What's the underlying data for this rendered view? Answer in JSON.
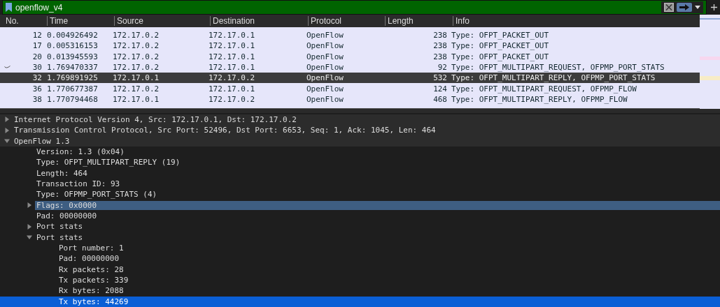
{
  "filter": {
    "value": "openflow_v4"
  },
  "packet_list": {
    "columns": [
      "No.",
      "Time",
      "Source",
      "Destination",
      "Protocol",
      "Length",
      "Info"
    ],
    "rows": [
      {
        "no": "12",
        "time": "0.004926492",
        "source": "172.17.0.2",
        "destination": "172.17.0.1",
        "protocol": "OpenFlow",
        "length": "238",
        "info": "Type: OFPT_PACKET_OUT",
        "selected": false,
        "related": false
      },
      {
        "no": "17",
        "time": "0.005316153",
        "source": "172.17.0.2",
        "destination": "172.17.0.1",
        "protocol": "OpenFlow",
        "length": "238",
        "info": "Type: OFPT_PACKET_OUT",
        "selected": false,
        "related": false
      },
      {
        "no": "20",
        "time": "0.013945593",
        "source": "172.17.0.2",
        "destination": "172.17.0.1",
        "protocol": "OpenFlow",
        "length": "238",
        "info": "Type: OFPT_PACKET_OUT",
        "selected": false,
        "related": false
      },
      {
        "no": "30",
        "time": "1.769470337",
        "source": "172.17.0.2",
        "destination": "172.17.0.1",
        "protocol": "OpenFlow",
        "length": "92",
        "info": "Type: OFPT_MULTIPART_REQUEST, OFPMP_PORT_STATS",
        "selected": false,
        "related": true
      },
      {
        "no": "32",
        "time": "1.769891925",
        "source": "172.17.0.1",
        "destination": "172.17.0.2",
        "protocol": "OpenFlow",
        "length": "532",
        "info": "Type: OFPT_MULTIPART_REPLY, OFPMP_PORT_STATS",
        "selected": true,
        "related": false
      },
      {
        "no": "36",
        "time": "1.770677387",
        "source": "172.17.0.2",
        "destination": "172.17.0.1",
        "protocol": "OpenFlow",
        "length": "124",
        "info": "Type: OFPT_MULTIPART_REQUEST, OFPMP_FLOW",
        "selected": false,
        "related": false
      },
      {
        "no": "38",
        "time": "1.770794468",
        "source": "172.17.0.1",
        "destination": "172.17.0.2",
        "protocol": "OpenFlow",
        "length": "468",
        "info": "Type: OFPT_MULTIPART_REPLY, OFPMP_FLOW",
        "selected": false,
        "related": false
      }
    ]
  },
  "details": [
    {
      "label": "Internet Protocol Version 4, Src: 172.17.0.1, Dst: 172.17.0.2",
      "expanded": false,
      "selected": false,
      "related": false
    },
    {
      "label": "Transmission Control Protocol, Src Port: 52496, Dst Port: 6653, Seq: 1, Ack: 1045, Len: 464",
      "expanded": false,
      "selected": false,
      "related": false
    },
    {
      "label": "OpenFlow 1.3",
      "expanded": true,
      "selected": false,
      "related": false,
      "children": [
        {
          "label": "Version: 1.3 (0x04)",
          "selected": false,
          "related": false
        },
        {
          "label": "Type: OFPT_MULTIPART_REPLY (19)",
          "selected": false,
          "related": false
        },
        {
          "label": "Length: 464",
          "selected": false,
          "related": false
        },
        {
          "label": "Transaction ID: 93",
          "selected": false,
          "related": false
        },
        {
          "label": "Type: OFPMP_PORT_STATS (4)",
          "selected": false,
          "related": false
        },
        {
          "label": "Flags: 0x0000",
          "expanded": false,
          "selected": false,
          "related": true
        },
        {
          "label": "Pad: 00000000",
          "selected": false,
          "related": false
        },
        {
          "label": "Port stats",
          "expanded": false,
          "selected": false,
          "related": false
        },
        {
          "label": "Port stats",
          "expanded": true,
          "selected": false,
          "related": false,
          "children": [
            {
              "label": "Port number: 1",
              "selected": false,
              "related": false
            },
            {
              "label": "Pad: 00000000",
              "selected": false,
              "related": false
            },
            {
              "label": "Rx packets: 28",
              "selected": false,
              "related": false
            },
            {
              "label": "Tx packets: 339",
              "selected": false,
              "related": false
            },
            {
              "label": "Rx bytes: 2088",
              "selected": false,
              "related": false
            },
            {
              "label": "Tx bytes: 44269",
              "selected": true,
              "related": false
            }
          ]
        }
      ]
    }
  ]
}
